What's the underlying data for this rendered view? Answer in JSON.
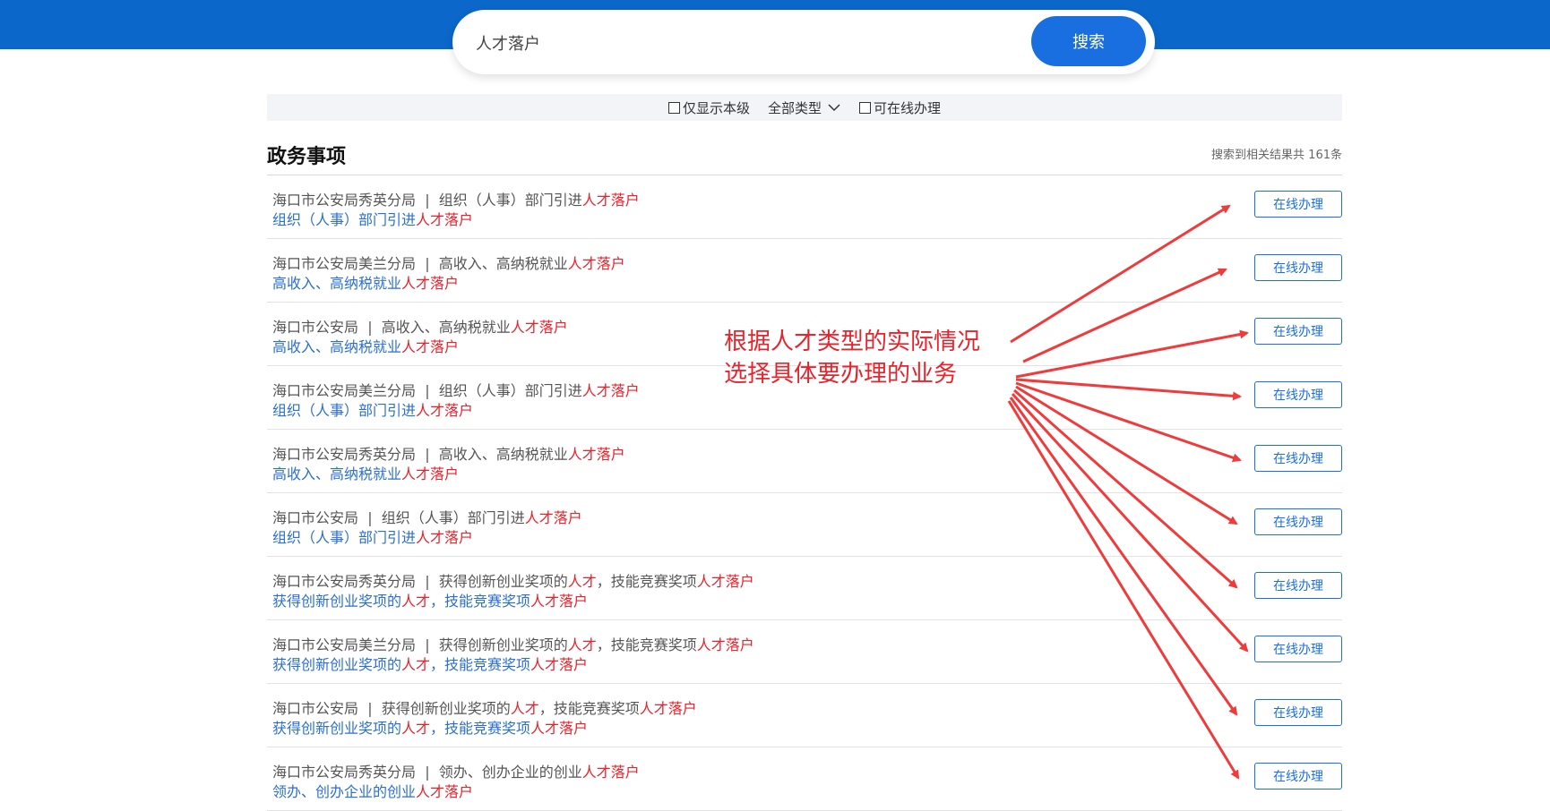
{
  "search": {
    "query": "人才落户",
    "button_label": "搜索"
  },
  "filters": {
    "current_level_label": "仅显示本级",
    "type_select_label": "全部类型",
    "online_label": "可在线办理"
  },
  "section": {
    "title": "政务事项",
    "count_text": "搜索到相关结果共 161条"
  },
  "results": [
    {
      "meta_dept": "海口市公安局秀英分局",
      "meta_sep": "|",
      "meta_item": "组织（人事）部门引进",
      "meta_hl": "人才落户",
      "name_pre": "组织（人事）部门引进",
      "name_hl": "人才落户",
      "button": "在线办理"
    },
    {
      "meta_dept": "海口市公安局美兰分局",
      "meta_sep": "|",
      "meta_item": "高收入、高纳税就业",
      "meta_hl": "人才落户",
      "name_pre": "高收入、高纳税就业",
      "name_hl": "人才落户",
      "button": "在线办理"
    },
    {
      "meta_dept": "海口市公安局",
      "meta_sep": "|",
      "meta_item": "高收入、高纳税就业",
      "meta_hl": "人才落户",
      "name_pre": "高收入、高纳税就业",
      "name_hl": "人才落户",
      "button": "在线办理"
    },
    {
      "meta_dept": "海口市公安局美兰分局",
      "meta_sep": "|",
      "meta_item": "组织（人事）部门引进",
      "meta_hl": "人才落户",
      "name_pre": "组织（人事）部门引进",
      "name_hl": "人才落户",
      "button": "在线办理"
    },
    {
      "meta_dept": "海口市公安局秀英分局",
      "meta_sep": "|",
      "meta_item": "高收入、高纳税就业",
      "meta_hl": "人才落户",
      "name_pre": "高收入、高纳税就业",
      "name_hl": "人才落户",
      "button": "在线办理"
    },
    {
      "meta_dept": "海口市公安局",
      "meta_sep": "|",
      "meta_item": "组织（人事）部门引进",
      "meta_hl": "人才落户",
      "name_pre": "组织（人事）部门引进",
      "name_hl": "人才落户",
      "button": "在线办理"
    },
    {
      "meta_dept": "海口市公安局秀英分局",
      "meta_sep": "|",
      "meta_item": "获得创新创业奖项的",
      "meta_hl": "人才",
      "meta_item2": "，技能竞赛奖项",
      "meta_hl2": "人才落户",
      "name_pre": "获得创新创业奖项的",
      "name_hl": "人才",
      "name_mid": "，技能竞赛奖项",
      "name_hl2": "人才落户",
      "button": "在线办理"
    },
    {
      "meta_dept": "海口市公安局美兰分局",
      "meta_sep": "|",
      "meta_item": "获得创新创业奖项的",
      "meta_hl": "人才",
      "meta_item2": "，技能竞赛奖项",
      "meta_hl2": "人才落户",
      "name_pre": "获得创新创业奖项的",
      "name_hl": "人才",
      "name_mid": "，技能竞赛奖项",
      "name_hl2": "人才落户",
      "button": "在线办理"
    },
    {
      "meta_dept": "海口市公安局",
      "meta_sep": "|",
      "meta_item": "获得创新创业奖项的",
      "meta_hl": "人才",
      "meta_item2": "，技能竞赛奖项",
      "meta_hl2": "人才落户",
      "name_pre": "获得创新创业奖项的",
      "name_hl": "人才",
      "name_mid": "，技能竞赛奖项",
      "name_hl2": "人才落户",
      "button": "在线办理"
    },
    {
      "meta_dept": "海口市公安局秀英分局",
      "meta_sep": "|",
      "meta_item": "领办、创办企业的创业",
      "meta_hl": "人才落户",
      "name_pre": "领办、创办企业的创业",
      "name_hl": "人才落户",
      "button": "在线办理"
    }
  ],
  "annotation": {
    "line1": "根据人才类型的实际情况",
    "line2": "选择具体要办理的业务"
  },
  "colors": {
    "header_blue": "#0b67c9",
    "button_blue": "#1a6fe0",
    "link_blue": "#2b6fd1",
    "highlight_red": "#e8232c"
  }
}
